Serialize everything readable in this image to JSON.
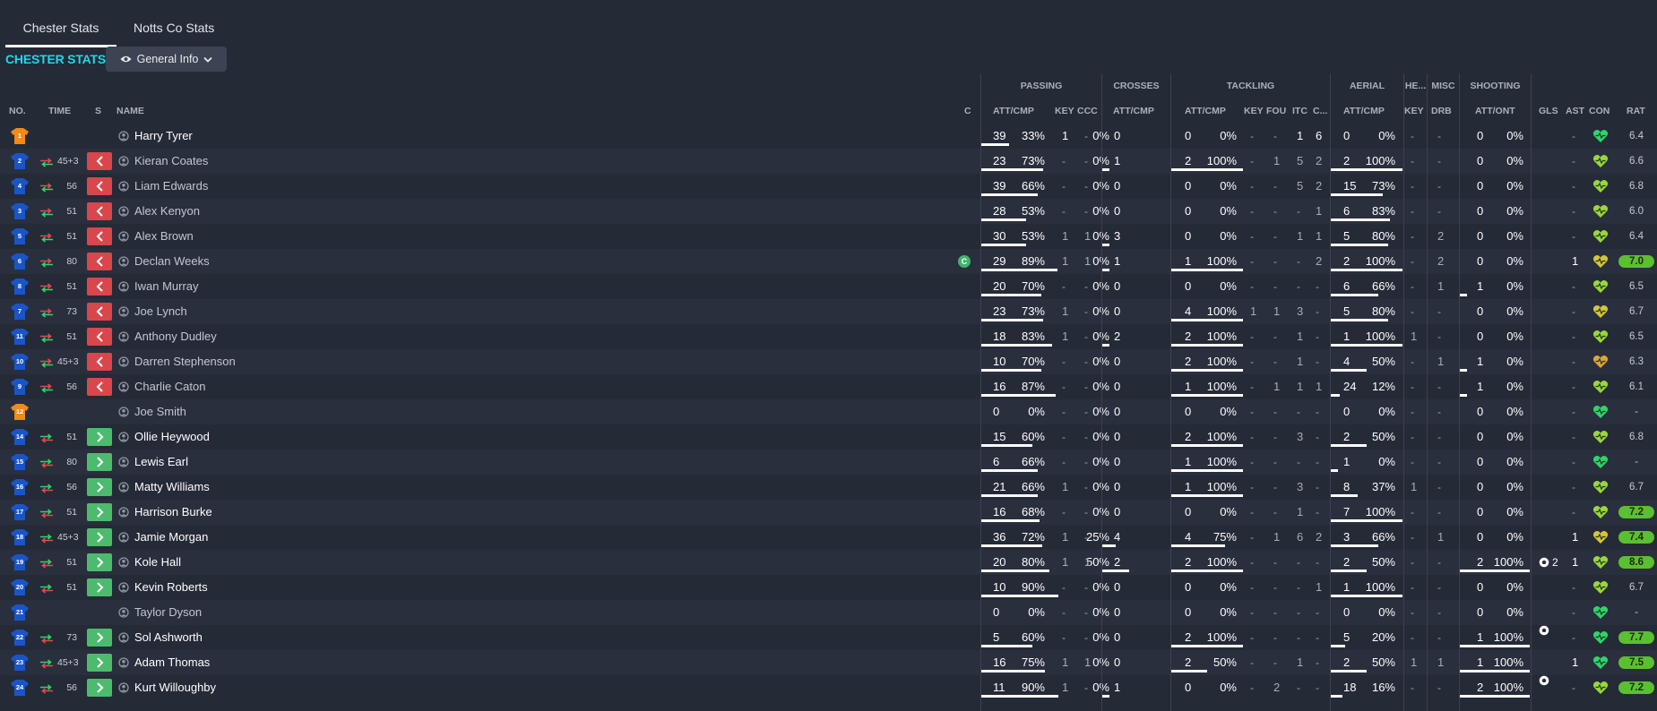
{
  "tabs": [
    {
      "label": "Chester Stats",
      "active": true
    },
    {
      "label": "Notts Co Stats",
      "active": false
    }
  ],
  "section_title": "CHESTER STATS",
  "view_selector": {
    "label": "General Info",
    "icon": "eye-icon"
  },
  "group_headers": {
    "passing": "PASSING",
    "crosses": "CROSSES",
    "tackling": "TACKLING",
    "aerial": "AERIAL",
    "headers": "HE...",
    "misc": "MISC",
    "shooting": "SHOOTING"
  },
  "columns": {
    "no": "NO.",
    "time": "TIME",
    "s": "S",
    "name": "NAME",
    "c": "C",
    "pass_attcmp": "ATT/CMP",
    "key": "KEY",
    "ccc": "CCC",
    "cross_attcmp": "ATT/CMP",
    "tack_attcmp": "ATT/CMP",
    "tack_key": "KEY",
    "fou": "FOU",
    "itc": "ITC",
    "cla": "C...",
    "aer_attcmp": "ATT/CMP",
    "he_key": "KEY",
    "drb": "DRB",
    "shot_attont": "ATT/ONT",
    "gls": "GLS",
    "ast": "AST",
    "con": "CON",
    "rat": "RAT"
  },
  "colors": {
    "background": "#252a37",
    "accent": "#1fd7e8",
    "sub_off": "#d9464b",
    "sub_on": "#4dbb6e",
    "keeper_shirt": "#f08a18",
    "outfield_shirt": "#1a55c8",
    "high_rating": "#5bc02f",
    "condition_good": "#2fd46a"
  },
  "players": [
    {
      "no": "1",
      "gk": true,
      "sub": "",
      "time": "",
      "name": "Harry Tyrer",
      "played": true,
      "cap": false,
      "pass": [
        "39",
        "33%"
      ],
      "pfill": 0.33,
      "key": "1",
      "ccc": "-",
      "cross": [
        "0",
        "0%"
      ],
      "cfill": 0,
      "tack": [
        "0",
        "0%"
      ],
      "tfill": 0,
      "tkey": "-",
      "fou": "-",
      "itc": "1",
      "cla": "6",
      "aer": [
        "0",
        "0%"
      ],
      "afill": 0,
      "hkey": "-",
      "drb": "-",
      "shot": [
        "0",
        "0%"
      ],
      "sfill": 0,
      "gls": "",
      "gls_icon": false,
      "ast": "-",
      "con": "green",
      "rat": "6.4"
    },
    {
      "no": "2",
      "gk": false,
      "sub": "off",
      "time": "45+3",
      "name": "Kieran Coates",
      "played": true,
      "cap": false,
      "pass": [
        "23",
        "73%"
      ],
      "pfill": 0.73,
      "key": "-",
      "ccc": "-",
      "cross": [
        "1",
        "0%"
      ],
      "cfill": 0,
      "tack": [
        "2",
        "100%"
      ],
      "tfill": 1,
      "tkey": "-",
      "fou": "1",
      "itc": "5",
      "cla": "2",
      "aer": [
        "2",
        "100%"
      ],
      "afill": 1,
      "hkey": "-",
      "drb": "-",
      "shot": [
        "0",
        "0%"
      ],
      "sfill": 0,
      "gls": "",
      "gls_icon": false,
      "ast": "-",
      "con": "yellowgreen",
      "rat": "6.6"
    },
    {
      "no": "4",
      "gk": false,
      "sub": "off",
      "time": "56",
      "name": "Liam Edwards",
      "played": true,
      "cap": false,
      "pass": [
        "39",
        "66%"
      ],
      "pfill": 0.66,
      "key": "-",
      "ccc": "-",
      "cross": [
        "0",
        "0%"
      ],
      "cfill": 0,
      "tack": [
        "0",
        "0%"
      ],
      "tfill": 0,
      "tkey": "-",
      "fou": "-",
      "itc": "5",
      "cla": "2",
      "aer": [
        "15",
        "73%"
      ],
      "afill": 0.73,
      "hkey": "-",
      "drb": "-",
      "shot": [
        "0",
        "0%"
      ],
      "sfill": 0,
      "gls": "",
      "gls_icon": false,
      "ast": "-",
      "con": "yellowgreen",
      "rat": "6.8"
    },
    {
      "no": "3",
      "gk": false,
      "sub": "off",
      "time": "51",
      "name": "Alex Kenyon",
      "played": true,
      "cap": false,
      "pass": [
        "28",
        "53%"
      ],
      "pfill": 0.53,
      "key": "-",
      "ccc": "-",
      "cross": [
        "0",
        "0%"
      ],
      "cfill": 0,
      "tack": [
        "0",
        "0%"
      ],
      "tfill": 0,
      "tkey": "-",
      "fou": "-",
      "itc": "-",
      "cla": "1",
      "aer": [
        "6",
        "83%"
      ],
      "afill": 0.83,
      "hkey": "-",
      "drb": "-",
      "shot": [
        "0",
        "0%"
      ],
      "sfill": 0,
      "gls": "",
      "gls_icon": false,
      "ast": "-",
      "con": "yellowgreen",
      "rat": "6.0"
    },
    {
      "no": "5",
      "gk": false,
      "sub": "off",
      "time": "51",
      "name": "Alex Brown",
      "played": true,
      "cap": false,
      "pass": [
        "30",
        "53%"
      ],
      "pfill": 0.53,
      "key": "1",
      "ccc": "1",
      "cross": [
        "3",
        "0%"
      ],
      "cfill": 0,
      "tack": [
        "0",
        "0%"
      ],
      "tfill": 0,
      "tkey": "-",
      "fou": "-",
      "itc": "1",
      "cla": "1",
      "aer": [
        "5",
        "80%"
      ],
      "afill": 0.8,
      "hkey": "-",
      "drb": "2",
      "shot": [
        "0",
        "0%"
      ],
      "sfill": 0,
      "gls": "",
      "gls_icon": false,
      "ast": "-",
      "con": "yellowgreen",
      "rat": "6.4"
    },
    {
      "no": "6",
      "gk": false,
      "sub": "off",
      "time": "80",
      "name": "Declan Weeks",
      "played": true,
      "cap": true,
      "pass": [
        "29",
        "89%"
      ],
      "pfill": 0.89,
      "key": "1",
      "ccc": "1",
      "cross": [
        "1",
        "0%"
      ],
      "cfill": 0,
      "tack": [
        "1",
        "100%"
      ],
      "tfill": 1,
      "tkey": "-",
      "fou": "-",
      "itc": "-",
      "cla": "2",
      "aer": [
        "2",
        "100%"
      ],
      "afill": 1,
      "hkey": "-",
      "drb": "2",
      "shot": [
        "0",
        "0%"
      ],
      "sfill": 0,
      "gls": "",
      "gls_icon": false,
      "ast": "1",
      "con": "yellow",
      "rat": "7.0"
    },
    {
      "no": "8",
      "gk": false,
      "sub": "off",
      "time": "51",
      "name": "Iwan Murray",
      "played": true,
      "cap": false,
      "pass": [
        "20",
        "70%"
      ],
      "pfill": 0.7,
      "key": "-",
      "ccc": "-",
      "cross": [
        "0",
        "0%"
      ],
      "cfill": 0,
      "tack": [
        "0",
        "0%"
      ],
      "tfill": 0,
      "tkey": "-",
      "fou": "-",
      "itc": "-",
      "cla": "-",
      "aer": [
        "6",
        "66%"
      ],
      "afill": 0.66,
      "hkey": "-",
      "drb": "1",
      "shot": [
        "1",
        "0%"
      ],
      "sfill": 0,
      "gls": "",
      "gls_icon": false,
      "ast": "-",
      "con": "yellowgreen",
      "rat": "6.5"
    },
    {
      "no": "7",
      "gk": false,
      "sub": "off",
      "time": "73",
      "name": "Joe Lynch",
      "played": true,
      "cap": false,
      "pass": [
        "23",
        "73%"
      ],
      "pfill": 0.73,
      "key": "1",
      "ccc": "-",
      "cross": [
        "0",
        "0%"
      ],
      "cfill": 0,
      "tack": [
        "4",
        "100%"
      ],
      "tfill": 1,
      "tkey": "1",
      "fou": "1",
      "itc": "3",
      "cla": "-",
      "aer": [
        "5",
        "80%"
      ],
      "afill": 0.8,
      "hkey": "-",
      "drb": "-",
      "shot": [
        "0",
        "0%"
      ],
      "sfill": 0,
      "gls": "",
      "gls_icon": false,
      "ast": "-",
      "con": "yellow",
      "rat": "6.7"
    },
    {
      "no": "11",
      "gk": false,
      "sub": "off",
      "time": "51",
      "name": "Anthony Dudley",
      "played": true,
      "cap": false,
      "pass": [
        "18",
        "83%"
      ],
      "pfill": 0.83,
      "key": "1",
      "ccc": "-",
      "cross": [
        "2",
        "0%"
      ],
      "cfill": 0,
      "tack": [
        "2",
        "100%"
      ],
      "tfill": 1,
      "tkey": "-",
      "fou": "-",
      "itc": "1",
      "cla": "-",
      "aer": [
        "1",
        "100%"
      ],
      "afill": 1,
      "hkey": "1",
      "drb": "-",
      "shot": [
        "0",
        "0%"
      ],
      "sfill": 0,
      "gls": "",
      "gls_icon": false,
      "ast": "-",
      "con": "yellowgreen",
      "rat": "6.5"
    },
    {
      "no": "10",
      "gk": false,
      "sub": "off",
      "time": "45+3",
      "name": "Darren Stephenson",
      "played": true,
      "cap": false,
      "pass": [
        "10",
        "70%"
      ],
      "pfill": 0.7,
      "key": "-",
      "ccc": "-",
      "cross": [
        "0",
        "0%"
      ],
      "cfill": 0,
      "tack": [
        "2",
        "100%"
      ],
      "tfill": 1,
      "tkey": "-",
      "fou": "-",
      "itc": "1",
      "cla": "-",
      "aer": [
        "4",
        "50%"
      ],
      "afill": 0.5,
      "hkey": "-",
      "drb": "1",
      "shot": [
        "1",
        "0%"
      ],
      "sfill": 0,
      "gls": "",
      "gls_icon": false,
      "ast": "-",
      "con": "orange",
      "rat": "6.3"
    },
    {
      "no": "9",
      "gk": false,
      "sub": "off",
      "time": "56",
      "name": "Charlie Caton",
      "played": true,
      "cap": false,
      "pass": [
        "16",
        "87%"
      ],
      "pfill": 0.87,
      "key": "-",
      "ccc": "-",
      "cross": [
        "0",
        "0%"
      ],
      "cfill": 0,
      "tack": [
        "1",
        "100%"
      ],
      "tfill": 1,
      "tkey": "-",
      "fou": "1",
      "itc": "1",
      "cla": "1",
      "aer": [
        "24",
        "12%"
      ],
      "afill": 0.12,
      "hkey": "-",
      "drb": "-",
      "shot": [
        "1",
        "0%"
      ],
      "sfill": 0,
      "gls": "",
      "gls_icon": false,
      "ast": "-",
      "con": "yellowgreen",
      "rat": "6.1"
    },
    {
      "no": "12",
      "gk": true,
      "sub": "",
      "time": "",
      "name": "Joe Smith",
      "played": false,
      "cap": false,
      "pass": [
        "0",
        "0%"
      ],
      "pfill": 0,
      "key": "-",
      "ccc": "-",
      "cross": [
        "0",
        "0%"
      ],
      "cfill": 0,
      "tack": [
        "0",
        "0%"
      ],
      "tfill": 0,
      "tkey": "-",
      "fou": "-",
      "itc": "-",
      "cla": "-",
      "aer": [
        "0",
        "0%"
      ],
      "afill": 0,
      "hkey": "-",
      "drb": "-",
      "shot": [
        "0",
        "0%"
      ],
      "sfill": 0,
      "gls": "",
      "gls_icon": false,
      "ast": "-",
      "con": "green",
      "rat": "-"
    },
    {
      "no": "14",
      "gk": false,
      "sub": "on",
      "time": "51",
      "name": "Ollie Heywood",
      "played": true,
      "cap": false,
      "pass": [
        "15",
        "60%"
      ],
      "pfill": 0.6,
      "key": "-",
      "ccc": "-",
      "cross": [
        "0",
        "0%"
      ],
      "cfill": 0,
      "tack": [
        "2",
        "100%"
      ],
      "tfill": 1,
      "tkey": "-",
      "fou": "-",
      "itc": "3",
      "cla": "-",
      "aer": [
        "2",
        "50%"
      ],
      "afill": 0.5,
      "hkey": "-",
      "drb": "-",
      "shot": [
        "0",
        "0%"
      ],
      "sfill": 0,
      "gls": "",
      "gls_icon": false,
      "ast": "-",
      "con": "yellowgreen",
      "rat": "6.8"
    },
    {
      "no": "15",
      "gk": false,
      "sub": "on",
      "time": "80",
      "name": "Lewis Earl",
      "played": true,
      "cap": false,
      "pass": [
        "6",
        "66%"
      ],
      "pfill": 0.66,
      "key": "-",
      "ccc": "-",
      "cross": [
        "0",
        "0%"
      ],
      "cfill": 0,
      "tack": [
        "1",
        "100%"
      ],
      "tfill": 1,
      "tkey": "-",
      "fou": "-",
      "itc": "-",
      "cla": "-",
      "aer": [
        "1",
        "0%"
      ],
      "afill": 0,
      "hkey": "-",
      "drb": "-",
      "shot": [
        "0",
        "0%"
      ],
      "sfill": 0,
      "gls": "",
      "gls_icon": false,
      "ast": "-",
      "con": "green",
      "rat": "-"
    },
    {
      "no": "16",
      "gk": false,
      "sub": "on",
      "time": "56",
      "name": "Matty Williams",
      "played": true,
      "cap": false,
      "pass": [
        "21",
        "66%"
      ],
      "pfill": 0.66,
      "key": "1",
      "ccc": "-",
      "cross": [
        "0",
        "0%"
      ],
      "cfill": 0,
      "tack": [
        "1",
        "100%"
      ],
      "tfill": 1,
      "tkey": "-",
      "fou": "-",
      "itc": "3",
      "cla": "-",
      "aer": [
        "8",
        "37%"
      ],
      "afill": 0.37,
      "hkey": "1",
      "drb": "-",
      "shot": [
        "0",
        "0%"
      ],
      "sfill": 0,
      "gls": "",
      "gls_icon": false,
      "ast": "-",
      "con": "yellowgreen",
      "rat": "6.7"
    },
    {
      "no": "17",
      "gk": false,
      "sub": "on",
      "time": "51",
      "name": "Harrison Burke",
      "played": true,
      "cap": false,
      "pass": [
        "16",
        "68%"
      ],
      "pfill": 0.68,
      "key": "-",
      "ccc": "-",
      "cross": [
        "0",
        "0%"
      ],
      "cfill": 0,
      "tack": [
        "0",
        "0%"
      ],
      "tfill": 0,
      "tkey": "-",
      "fou": "-",
      "itc": "1",
      "cla": "-",
      "aer": [
        "7",
        "100%"
      ],
      "afill": 1,
      "hkey": "-",
      "drb": "-",
      "shot": [
        "0",
        "0%"
      ],
      "sfill": 0,
      "gls": "",
      "gls_icon": false,
      "ast": "-",
      "con": "yellowgreen",
      "rat": "7.2"
    },
    {
      "no": "18",
      "gk": false,
      "sub": "on",
      "time": "45+3",
      "name": "Jamie Morgan",
      "played": true,
      "cap": false,
      "pass": [
        "36",
        "72%"
      ],
      "pfill": 0.72,
      "key": "1",
      "ccc": "-",
      "cross": [
        "4",
        "25%"
      ],
      "cfill": 0.25,
      "tack": [
        "4",
        "75%"
      ],
      "tfill": 0.75,
      "tkey": "-",
      "fou": "1",
      "itc": "6",
      "cla": "2",
      "aer": [
        "3",
        "66%"
      ],
      "afill": 0.66,
      "hkey": "-",
      "drb": "1",
      "shot": [
        "0",
        "0%"
      ],
      "sfill": 0,
      "gls": "",
      "gls_icon": false,
      "ast": "1",
      "con": "yellow",
      "rat": "7.4"
    },
    {
      "no": "19",
      "gk": false,
      "sub": "on",
      "time": "51",
      "name": "Kole Hall",
      "played": true,
      "cap": false,
      "pass": [
        "20",
        "80%"
      ],
      "pfill": 0.8,
      "key": "1",
      "ccc": "1",
      "cross": [
        "2",
        "50%"
      ],
      "cfill": 0.5,
      "tack": [
        "2",
        "100%"
      ],
      "tfill": 1,
      "tkey": "-",
      "fou": "-",
      "itc": "-",
      "cla": "-",
      "aer": [
        "2",
        "50%"
      ],
      "afill": 0.5,
      "hkey": "-",
      "drb": "-",
      "shot": [
        "2",
        "100%"
      ],
      "sfill": 1,
      "gls": "2",
      "gls_icon": true,
      "ast": "1",
      "con": "yellowgreen",
      "rat": "8.6"
    },
    {
      "no": "20",
      "gk": false,
      "sub": "on",
      "time": "51",
      "name": "Kevin Roberts",
      "played": true,
      "cap": false,
      "pass": [
        "10",
        "90%"
      ],
      "pfill": 0.9,
      "key": "-",
      "ccc": "-",
      "cross": [
        "0",
        "0%"
      ],
      "cfill": 0,
      "tack": [
        "0",
        "0%"
      ],
      "tfill": 0,
      "tkey": "-",
      "fou": "-",
      "itc": "-",
      "cla": "1",
      "aer": [
        "1",
        "100%"
      ],
      "afill": 1,
      "hkey": "-",
      "drb": "-",
      "shot": [
        "0",
        "0%"
      ],
      "sfill": 0,
      "gls": "",
      "gls_icon": false,
      "ast": "-",
      "con": "yellowgreen",
      "rat": "6.7"
    },
    {
      "no": "21",
      "gk": false,
      "sub": "",
      "time": "",
      "name": "Taylor Dyson",
      "played": false,
      "cap": false,
      "pass": [
        "0",
        "0%"
      ],
      "pfill": 0,
      "key": "-",
      "ccc": "-",
      "cross": [
        "0",
        "0%"
      ],
      "cfill": 0,
      "tack": [
        "0",
        "0%"
      ],
      "tfill": 0,
      "tkey": "-",
      "fou": "-",
      "itc": "-",
      "cla": "-",
      "aer": [
        "0",
        "0%"
      ],
      "afill": 0,
      "hkey": "-",
      "drb": "-",
      "shot": [
        "0",
        "0%"
      ],
      "sfill": 0,
      "gls": "",
      "gls_icon": false,
      "ast": "-",
      "con": "green",
      "rat": "-"
    },
    {
      "no": "22",
      "gk": false,
      "sub": "on",
      "time": "73",
      "name": "Sol Ashworth",
      "played": true,
      "cap": false,
      "pass": [
        "5",
        "60%"
      ],
      "pfill": 0.6,
      "key": "-",
      "ccc": "-",
      "cross": [
        "0",
        "0%"
      ],
      "cfill": 0,
      "tack": [
        "2",
        "100%"
      ],
      "tfill": 1,
      "tkey": "-",
      "fou": "-",
      "itc": "-",
      "cla": "-",
      "aer": [
        "5",
        "20%"
      ],
      "afill": 0.2,
      "hkey": "-",
      "drb": "-",
      "shot": [
        "1",
        "100%"
      ],
      "sfill": 1,
      "gls": "",
      "gls_icon": true,
      "ast": "-",
      "con": "green",
      "rat": "7.7"
    },
    {
      "no": "23",
      "gk": false,
      "sub": "on",
      "time": "45+3",
      "name": "Adam Thomas",
      "played": true,
      "cap": false,
      "pass": [
        "16",
        "75%"
      ],
      "pfill": 0.75,
      "key": "1",
      "ccc": "1",
      "cross": [
        "0",
        "0%"
      ],
      "cfill": 0,
      "tack": [
        "2",
        "50%"
      ],
      "tfill": 0.5,
      "tkey": "-",
      "fou": "-",
      "itc": "1",
      "cla": "-",
      "aer": [
        "2",
        "50%"
      ],
      "afill": 0.5,
      "hkey": "1",
      "drb": "1",
      "shot": [
        "1",
        "100%"
      ],
      "sfill": 1,
      "gls": "",
      "gls_icon": false,
      "ast": "1",
      "con": "green",
      "rat": "7.5"
    },
    {
      "no": "24",
      "gk": false,
      "sub": "on",
      "time": "56",
      "name": "Kurt Willoughby",
      "played": true,
      "cap": false,
      "pass": [
        "11",
        "90%"
      ],
      "pfill": 0.9,
      "key": "1",
      "ccc": "-",
      "cross": [
        "1",
        "0%"
      ],
      "cfill": 0,
      "tack": [
        "0",
        "0%"
      ],
      "tfill": 0,
      "tkey": "-",
      "fou": "2",
      "itc": "-",
      "cla": "-",
      "aer": [
        "18",
        "16%"
      ],
      "afill": 0.16,
      "hkey": "-",
      "drb": "-",
      "shot": [
        "2",
        "100%"
      ],
      "sfill": 1,
      "gls": "",
      "gls_icon": true,
      "ast": "-",
      "con": "yellowgreen",
      "rat": "7.2"
    }
  ]
}
